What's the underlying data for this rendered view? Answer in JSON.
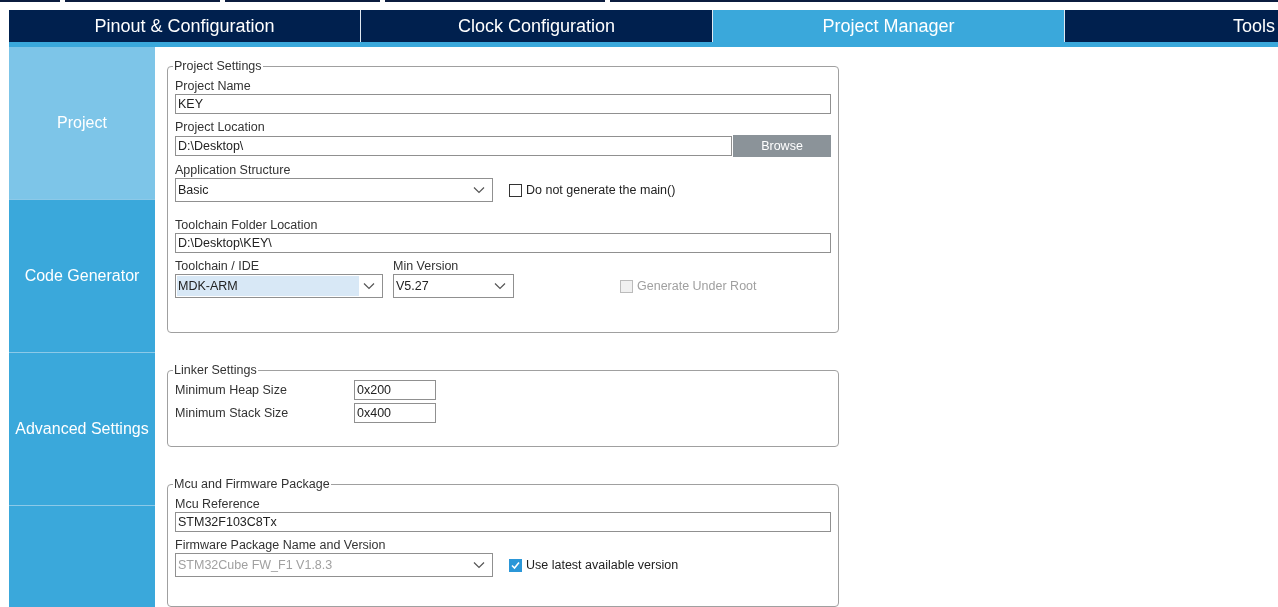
{
  "tabs": [
    {
      "label": "Pinout & Configuration",
      "selected": false
    },
    {
      "label": "Clock Configuration",
      "selected": false
    },
    {
      "label": "Project Manager",
      "selected": true
    },
    {
      "label": "Tools",
      "selected": false
    }
  ],
  "sidebar": {
    "items": [
      {
        "label": "Project",
        "selected": true
      },
      {
        "label": "Code Generator",
        "selected": false
      },
      {
        "label": "Advanced Settings",
        "selected": false
      }
    ]
  },
  "project_settings": {
    "title": "Project Settings",
    "project_name": {
      "label": "Project Name",
      "value": "KEY"
    },
    "project_location": {
      "label": "Project Location",
      "value": "D:\\Desktop\\",
      "button": "Browse"
    },
    "application_structure": {
      "label": "Application Structure",
      "value": "Basic",
      "checkbox": {
        "label": "Do not generate the main()",
        "checked": false,
        "disabled": false
      }
    },
    "toolchain_folder": {
      "label": "Toolchain Folder Location",
      "value": "D:\\Desktop\\KEY\\"
    },
    "toolchain_ide": {
      "label": "Toolchain / IDE",
      "value": "MDK-ARM",
      "focused": true,
      "disabled": false
    },
    "min_version": {
      "label": "Min Version",
      "value": "V5.27",
      "focused": false,
      "disabled": false
    },
    "generate_under_root": {
      "label": "Generate Under Root",
      "checked": false,
      "disabled": true
    }
  },
  "linker_settings": {
    "title": "Linker Settings",
    "rows": [
      {
        "label": "Minimum Heap Size",
        "value": "0x200"
      },
      {
        "label": "Minimum Stack Size",
        "value": "0x400"
      }
    ]
  },
  "mcu_firmware": {
    "title": "Mcu and Firmware Package",
    "mcu_reference": {
      "label": "Mcu Reference",
      "value": "STM32F103C8Tx"
    },
    "firmware_package": {
      "label": "Firmware Package Name and Version",
      "value": "STM32Cube FW_F1 V1.8.3",
      "focused": false,
      "disabled": true,
      "checkbox": {
        "label": "Use latest available version",
        "checked": true,
        "disabled": false
      }
    }
  }
}
